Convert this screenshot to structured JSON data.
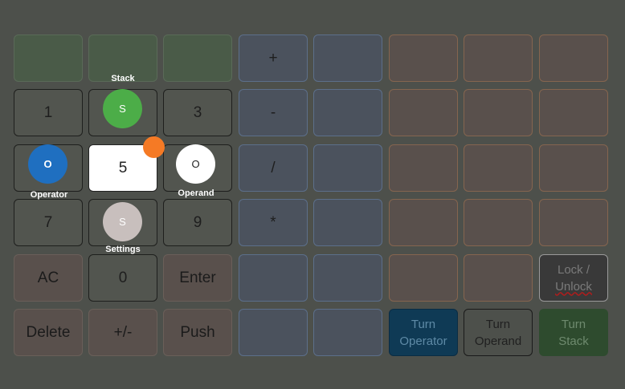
{
  "grid": {
    "row1": {
      "c1": "",
      "c2": "",
      "c3": "",
      "c4": "+",
      "c5": "",
      "c6": "",
      "c7": "",
      "c8": ""
    },
    "row2": {
      "c1": "1",
      "c2": "",
      "c3": "3",
      "c4": "-",
      "c5": "",
      "c6": "",
      "c7": "",
      "c8": ""
    },
    "row3": {
      "c1": "",
      "c2": "5",
      "c3": "",
      "c4": "/",
      "c5": "",
      "c6": "",
      "c7": "",
      "c8": ""
    },
    "row4": {
      "c1": "7",
      "c2": "",
      "c3": "9",
      "c4": "*",
      "c5": "",
      "c6": "",
      "c7": "",
      "c8": ""
    },
    "row5": {
      "c1": "AC",
      "c2": "0",
      "c3": "Enter",
      "c4": "",
      "c5": "",
      "c6": "",
      "c7": "",
      "lock_line1": "Lock /",
      "lock_line2": "Unlock"
    },
    "row6": {
      "c1": "Delete",
      "c2": "+/-",
      "c3": "Push",
      "c4": "",
      "c5": "",
      "turn_operator_1": "Turn",
      "turn_operator_2": "Operator",
      "turn_operand_1": "Turn",
      "turn_operand_2": "Operand",
      "turn_stack_1": "Turn",
      "turn_stack_2": "Stack"
    }
  },
  "tokens": {
    "stack": {
      "letter": "S",
      "label": "Stack",
      "color": "#4cad48"
    },
    "operator": {
      "letter": "O",
      "label": "Operator",
      "color": "#1f6fc0"
    },
    "operand": {
      "letter": "O",
      "label": "Operand",
      "color": "#ffffff"
    },
    "settings": {
      "letter": "S",
      "label": "Settings",
      "color": "#c8bfbd"
    },
    "marker": {
      "color": "#f57a25"
    }
  },
  "colors": {
    "background": "#4d504b",
    "turn_operator": "#0f3a55",
    "turn_stack": "#2e4b2e",
    "selected_cell": "#ffffff"
  }
}
